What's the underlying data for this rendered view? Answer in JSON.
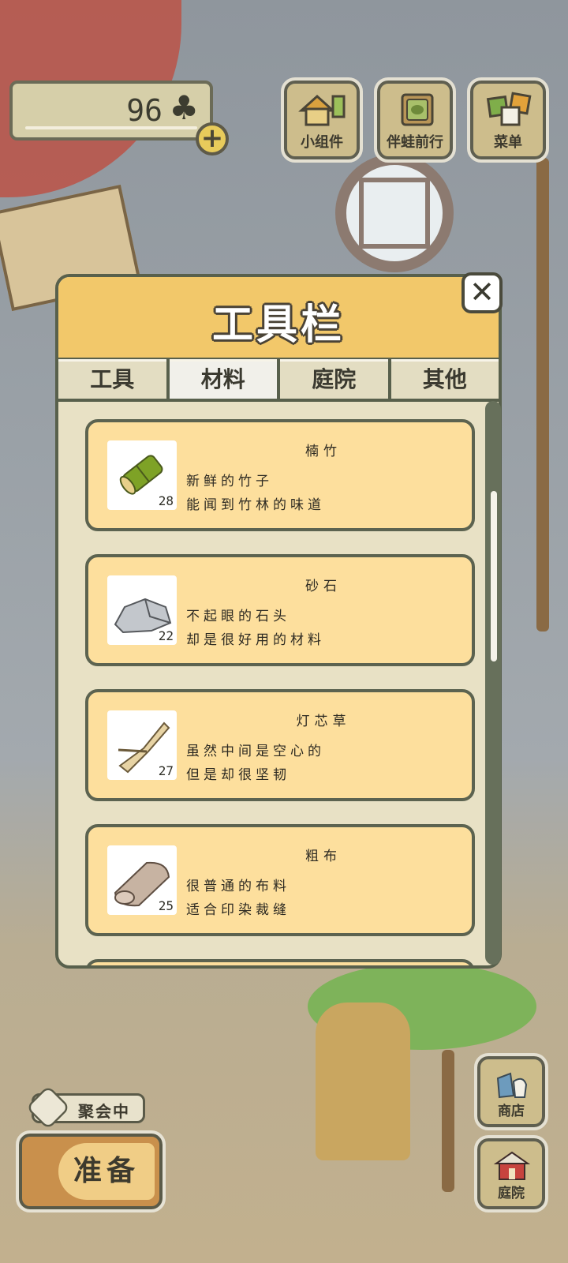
{
  "hud": {
    "clover_count": "96",
    "clover_icon": "♣",
    "plus_label": "+",
    "buttons": [
      {
        "label": "小组件",
        "icon": "widget-icon"
      },
      {
        "label": "伴蛙前行",
        "icon": "companion-book-icon"
      },
      {
        "label": "菜单",
        "icon": "menu-icon"
      }
    ]
  },
  "panel": {
    "title": "工具栏",
    "close_label": "✕",
    "tabs": [
      {
        "label": "工具",
        "active": false
      },
      {
        "label": "材料",
        "active": true
      },
      {
        "label": "庭院",
        "active": false
      },
      {
        "label": "其他",
        "active": false
      }
    ],
    "items": [
      {
        "name": "楠竹",
        "qty": "28",
        "desc1": "新鲜的竹子",
        "desc2": "能闻到竹林的味道",
        "icon": "bamboo-icon"
      },
      {
        "name": "砂石",
        "qty": "22",
        "desc1": "不起眼的石头",
        "desc2": "却是很好用的材料",
        "icon": "stone-icon"
      },
      {
        "name": "灯芯草",
        "qty": "27",
        "desc1": "虽然中间是空心的",
        "desc2": "但是却很坚韧",
        "icon": "rush-icon"
      },
      {
        "name": "粗布",
        "qty": "25",
        "desc1": "很普通的布料",
        "desc2": "适合印染裁缝",
        "icon": "cloth-icon"
      }
    ]
  },
  "bottom": {
    "party_label": "聚会中",
    "ready_label": "准备",
    "shop_label": "商店",
    "yard_label": "庭院"
  },
  "colors": {
    "panel_header": "#f2c86a",
    "card_bg": "#fddf9d",
    "border": "#58604c"
  }
}
